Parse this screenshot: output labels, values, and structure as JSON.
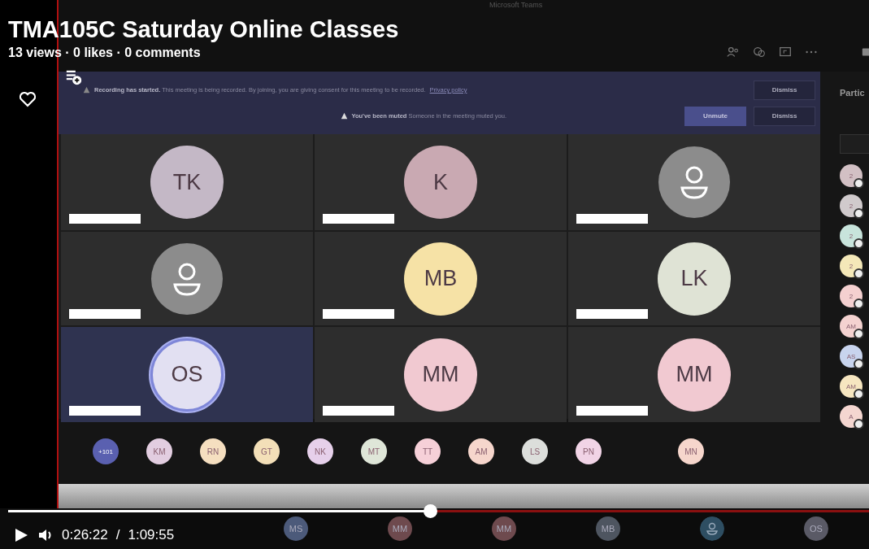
{
  "video": {
    "title": "TMA105C Saturday Online Classes",
    "stats": "13 views · 0 likes · 0 comments",
    "current_time": "0:26:22",
    "separator": "/",
    "duration": "1:09:55",
    "level": 0.49
  },
  "meeting": {
    "app_title": "Microsoft Teams",
    "banners": [
      {
        "kind": "recording",
        "heading": "Recording has started.",
        "message": "This meeting is being recorded. By joining, you are giving consent for this meeting to be recorded.",
        "link": "Privacy policy",
        "buttons": [
          {
            "label": "Dismiss",
            "primary": false
          }
        ]
      },
      {
        "kind": "muted",
        "heading": "You've been muted",
        "message": "Someone in the meeting muted you.",
        "buttons": [
          {
            "label": "Unmute",
            "primary": true
          },
          {
            "label": "Dismiss",
            "primary": false
          }
        ]
      }
    ],
    "tiles": [
      {
        "kind": "initials",
        "initials": "TK",
        "color": "#c4b8c6",
        "speaking": false
      },
      {
        "kind": "initials",
        "initials": "K",
        "color": "#c9a9b2",
        "speaking": false
      },
      {
        "kind": "person",
        "color": "#8c8c8c",
        "speaking": false
      },
      {
        "kind": "person",
        "color": "#8c8c8c",
        "speaking": false
      },
      {
        "kind": "initials",
        "initials": "MB",
        "color": "#f6e2a6",
        "speaking": false
      },
      {
        "kind": "initials",
        "initials": "LK",
        "color": "#dfe3d5",
        "speaking": false
      },
      {
        "kind": "initials",
        "initials": "OS",
        "color": "#e2e0f2",
        "speaking": true
      },
      {
        "kind": "initials",
        "initials": "MM",
        "color": "#f1c9d1",
        "speaking": false
      },
      {
        "kind": "initials",
        "initials": "MM",
        "color": "#f1c9d1",
        "speaking": false
      }
    ],
    "strip": [
      {
        "initials": "+101",
        "color": "#5a60b0"
      },
      {
        "initials": "KM",
        "color": "#e2cde0"
      },
      {
        "initials": "RN",
        "color": "#f5dfc0"
      },
      {
        "initials": "GT",
        "color": "#f3dfb8"
      },
      {
        "initials": "NK",
        "color": "#e6d0ea"
      },
      {
        "initials": "MT",
        "color": "#dfe6d8"
      },
      {
        "initials": "TT",
        "color": "#f6d0d8"
      },
      {
        "initials": "AM",
        "color": "#f6d6cc"
      },
      {
        "initials": "LS",
        "color": "#dcdedb"
      },
      {
        "initials": "PN",
        "color": "#f1d4e6"
      },
      {
        "initials": "MN",
        "color": "#f6d6cc"
      }
    ],
    "panel": {
      "title": "Partic",
      "participants": [
        {
          "initials": "2",
          "color": "#d2c0c4"
        },
        {
          "initials": "2",
          "color": "#d0cacc"
        },
        {
          "initials": "2",
          "color": "#c8e4dc"
        },
        {
          "initials": "2",
          "color": "#f4e8b8"
        },
        {
          "initials": "2",
          "color": "#f4d0d0"
        },
        {
          "initials": "AM",
          "color": "#f4d2d0"
        },
        {
          "initials": "AS",
          "color": "#c8d4ee"
        },
        {
          "initials": "AM",
          "color": "#f6e6c0"
        },
        {
          "initials": "A",
          "color": "#f4d6d0"
        }
      ]
    },
    "bottom_row": [
      {
        "kind": "initials",
        "initials": "MS",
        "color": "#4c5a7a"
      },
      {
        "kind": "initials",
        "initials": "MM",
        "color": "#6e4a4e"
      },
      {
        "kind": "initials",
        "initials": "MM",
        "color": "#6e4a4e"
      },
      {
        "kind": "initials",
        "initials": "MB",
        "color": "#4e5560"
      },
      {
        "kind": "person",
        "color": "#2e4e62"
      },
      {
        "kind": "initials",
        "initials": "OS",
        "color": "#5a5a66"
      }
    ]
  }
}
